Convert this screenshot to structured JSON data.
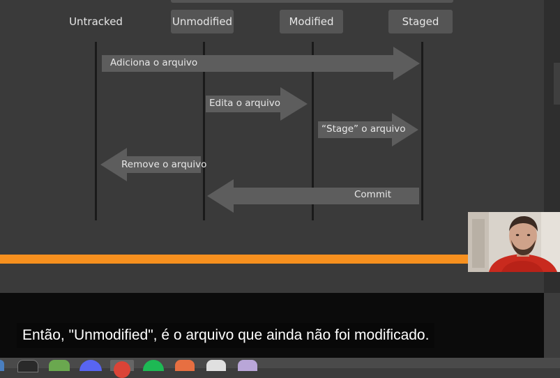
{
  "diagram": {
    "states": [
      {
        "id": "untracked",
        "label": "Untracked"
      },
      {
        "id": "unmodified",
        "label": "Unmodified"
      },
      {
        "id": "modified",
        "label": "Modified"
      },
      {
        "id": "staged",
        "label": "Staged"
      }
    ],
    "arrows": [
      {
        "label": "Adiciona o arquivo",
        "from": "untracked",
        "to": "staged"
      },
      {
        "label": "Edita o arquivo",
        "from": "unmodified",
        "to": "modified"
      },
      {
        "label": "“Stage” o arquivo",
        "from": "modified",
        "to": "staged"
      },
      {
        "label": "Remove o arquivo",
        "from": "unmodified",
        "to": "untracked"
      },
      {
        "label": "Commit",
        "from": "staged",
        "to": "unmodified"
      }
    ],
    "accent_color": "#f7901e"
  },
  "caption": {
    "text": "Então, \"Unmodified\", é o arquivo que ainda não foi modificado."
  },
  "webcam": {
    "content": "presenter-video"
  },
  "taskbar": {
    "icons": [
      "terminal-icon",
      "files-icon",
      "discord-icon",
      "chrome-icon",
      "spotify-icon",
      "app-icon",
      "editor-icon",
      "notes-icon"
    ]
  }
}
